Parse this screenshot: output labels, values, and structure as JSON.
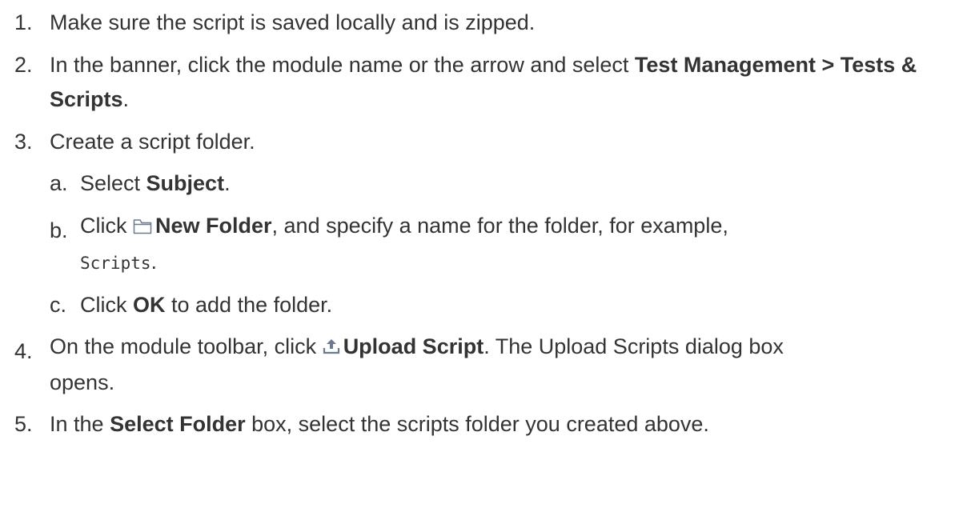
{
  "steps": [
    {
      "num": "1.",
      "text": "Make sure the script is saved locally and is zipped."
    },
    {
      "num": "2.",
      "text_before": "In the banner, click the module name or the arrow and select ",
      "bold": "Test Management > Tests & Scripts",
      "text_after": "."
    },
    {
      "num": "3.",
      "text": "Create a script folder.",
      "substeps": [
        {
          "num": "a.",
          "text_before": "Select ",
          "bold": "Subject",
          "text_after": "."
        },
        {
          "num": "b.",
          "text_before": "Click ",
          "icon": "folder-icon",
          "bold": "New Folder",
          "text_after": ", and specify a name for the folder, for example,",
          "code": "Scripts",
          "code_after": "."
        },
        {
          "num": "c.",
          "text_before": "Click ",
          "bold": "OK",
          "text_after": " to add the folder."
        }
      ]
    },
    {
      "num": "4.",
      "text_before": "On the module toolbar, click ",
      "icon": "upload-icon",
      "bold": "Upload Script",
      "text_after": ". The Upload Scripts dialog box",
      "text_cont": "opens."
    },
    {
      "num": "5.",
      "text_before": "In the ",
      "bold": "Select Folder",
      "text_after": " box, select the scripts folder you created above."
    }
  ],
  "colors": {
    "text": "#333333",
    "icon": "#6b7a8f"
  }
}
